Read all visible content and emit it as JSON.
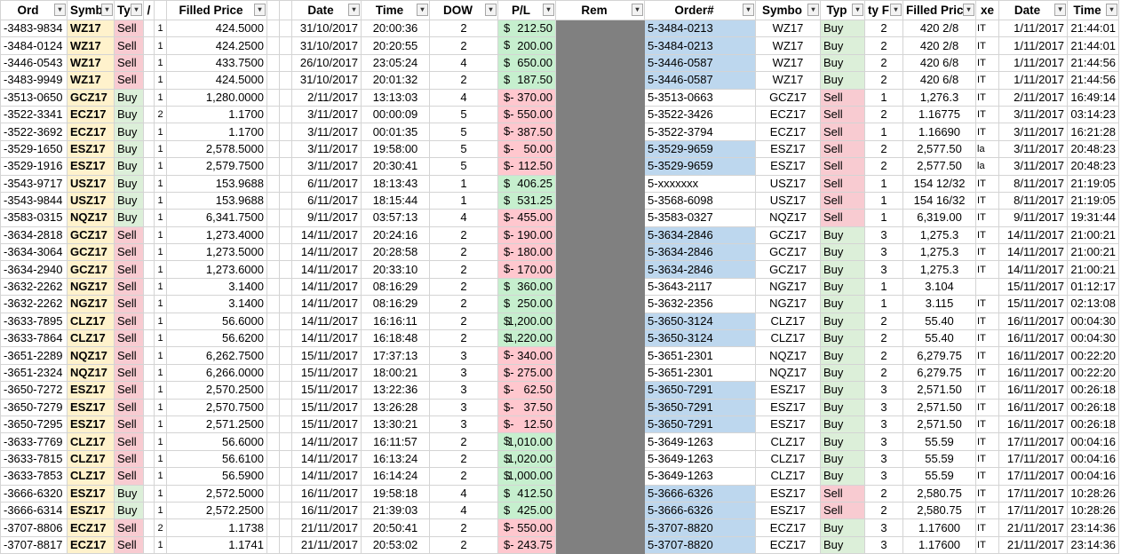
{
  "headers": {
    "ord": "Ord",
    "symb": "Symb",
    "ty": "Ty",
    "q": "/",
    "filled_price": "Filled Price",
    "date": "Date",
    "time": "Time",
    "dow": "DOW",
    "pl": "P/L",
    "rem": "Rem",
    "order_no": "Order#",
    "symbol2": "Symbo",
    "type2": "Typ",
    "qty2": "ty F",
    "filled_price2": "Filled Pric",
    "ex": "xe",
    "date2": "Date",
    "time2": "Time"
  },
  "currency_symbol": "$",
  "rows": [
    {
      "ord": "-3483-9834",
      "sym": "WZ17",
      "ty": "Sell",
      "q": "1",
      "fp": "424.5000",
      "date": "31/10/2017",
      "time": "20:00:36",
      "dow": "2",
      "sign": "",
      "pl": "212.50",
      "ord2": "5-3484-0213",
      "blue": true,
      "sym2": "WZ17",
      "ty2": "Buy",
      "q2": "2",
      "fp2": "420 2/8",
      "ex": "IT",
      "date2": "1/11/2017",
      "time2": "21:44:01"
    },
    {
      "ord": "-3484-0124",
      "sym": "WZ17",
      "ty": "Sell",
      "q": "1",
      "fp": "424.2500",
      "date": "31/10/2017",
      "time": "20:20:55",
      "dow": "2",
      "sign": "",
      "pl": "200.00",
      "ord2": "5-3484-0213",
      "blue": true,
      "sym2": "WZ17",
      "ty2": "Buy",
      "q2": "2",
      "fp2": "420 2/8",
      "ex": "IT",
      "date2": "1/11/2017",
      "time2": "21:44:01"
    },
    {
      "ord": "-3446-0543",
      "sym": "WZ17",
      "ty": "Sell",
      "q": "1",
      "fp": "433.7500",
      "date": "26/10/2017",
      "time": "23:05:24",
      "dow": "4",
      "sign": "",
      "pl": "650.00",
      "ord2": "5-3446-0587",
      "blue": true,
      "sym2": "WZ17",
      "ty2": "Buy",
      "q2": "2",
      "fp2": "420 6/8",
      "ex": "IT",
      "date2": "1/11/2017",
      "time2": "21:44:56"
    },
    {
      "ord": "-3483-9949",
      "sym": "WZ17",
      "ty": "Sell",
      "q": "1",
      "fp": "424.5000",
      "date": "31/10/2017",
      "time": "20:01:32",
      "dow": "2",
      "sign": "",
      "pl": "187.50",
      "ord2": "5-3446-0587",
      "blue": true,
      "sym2": "WZ17",
      "ty2": "Buy",
      "q2": "2",
      "fp2": "420 6/8",
      "ex": "IT",
      "date2": "1/11/2017",
      "time2": "21:44:56"
    },
    {
      "ord": "-3513-0650",
      "sym": "GCZ17",
      "ty": "Buy",
      "q": "1",
      "fp": "1,280.0000",
      "date": "2/11/2017",
      "time": "13:13:03",
      "dow": "4",
      "sign": "-",
      "pl": "370.00",
      "ord2": "5-3513-0663",
      "blue": false,
      "sym2": "GCZ17",
      "ty2": "Sell",
      "q2": "1",
      "fp2": "1,276.3",
      "ex": "IT",
      "date2": "2/11/2017",
      "time2": "16:49:14"
    },
    {
      "ord": "-3522-3341",
      "sym": "ECZ17",
      "ty": "Buy",
      "q": "2",
      "fp": "1.1700",
      "date": "3/11/2017",
      "time": "00:00:09",
      "dow": "5",
      "sign": "-",
      "pl": "550.00",
      "ord2": "5-3522-3426",
      "blue": false,
      "sym2": "ECZ17",
      "ty2": "Sell",
      "q2": "2",
      "fp2": "1.16775",
      "ex": "IT",
      "date2": "3/11/2017",
      "time2": "03:14:23"
    },
    {
      "ord": "-3522-3692",
      "sym": "ECZ17",
      "ty": "Buy",
      "q": "1",
      "fp": "1.1700",
      "date": "3/11/2017",
      "time": "00:01:35",
      "dow": "5",
      "sign": "-",
      "pl": "387.50",
      "ord2": "5-3522-3794",
      "blue": false,
      "sym2": "ECZ17",
      "ty2": "Sell",
      "q2": "1",
      "fp2": "1.16690",
      "ex": "IT",
      "date2": "3/11/2017",
      "time2": "16:21:28"
    },
    {
      "ord": "-3529-1650",
      "sym": "ESZ17",
      "ty": "Buy",
      "q": "1",
      "fp": "2,578.5000",
      "date": "3/11/2017",
      "time": "19:58:00",
      "dow": "5",
      "sign": "-",
      "pl": "50.00",
      "ord2": "5-3529-9659",
      "blue": true,
      "sym2": "ESZ17",
      "ty2": "Sell",
      "q2": "2",
      "fp2": "2,577.50",
      "ex": "la",
      "date2": "3/11/2017",
      "time2": "20:48:23"
    },
    {
      "ord": "-3529-1916",
      "sym": "ESZ17",
      "ty": "Buy",
      "q": "1",
      "fp": "2,579.7500",
      "date": "3/11/2017",
      "time": "20:30:41",
      "dow": "5",
      "sign": "-",
      "pl": "112.50",
      "ord2": "5-3529-9659",
      "blue": true,
      "sym2": "ESZ17",
      "ty2": "Sell",
      "q2": "2",
      "fp2": "2,577.50",
      "ex": "la",
      "date2": "3/11/2017",
      "time2": "20:48:23"
    },
    {
      "ord": "-3543-9717",
      "sym": "USZ17",
      "ty": "Buy",
      "q": "1",
      "fp": "153.9688",
      "date": "6/11/2017",
      "time": "18:13:43",
      "dow": "1",
      "sign": "",
      "pl": "406.25",
      "ord2": "5-xxxxxxx",
      "blue": false,
      "sym2": "USZ17",
      "ty2": "Sell",
      "q2": "1",
      "fp2": "154 12/32",
      "ex": "IT",
      "date2": "8/11/2017",
      "time2": "21:19:05"
    },
    {
      "ord": "-3543-9844",
      "sym": "USZ17",
      "ty": "Buy",
      "q": "1",
      "fp": "153.9688",
      "date": "6/11/2017",
      "time": "18:15:44",
      "dow": "1",
      "sign": "",
      "pl": "531.25",
      "ord2": "5-3568-6098",
      "blue": false,
      "sym2": "USZ17",
      "ty2": "Sell",
      "q2": "1",
      "fp2": "154 16/32",
      "ex": "IT",
      "date2": "8/11/2017",
      "time2": "21:19:05"
    },
    {
      "ord": "-3583-0315",
      "sym": "NQZ17",
      "ty": "Buy",
      "q": "1",
      "fp": "6,341.7500",
      "date": "9/11/2017",
      "time": "03:57:13",
      "dow": "4",
      "sign": "-",
      "pl": "455.00",
      "ord2": "5-3583-0327",
      "blue": false,
      "sym2": "NQZ17",
      "ty2": "Sell",
      "q2": "1",
      "fp2": "6,319.00",
      "ex": "IT",
      "date2": "9/11/2017",
      "time2": "19:31:44"
    },
    {
      "ord": "-3634-2818",
      "sym": "GCZ17",
      "ty": "Sell",
      "q": "1",
      "fp": "1,273.4000",
      "date": "14/11/2017",
      "time": "20:24:16",
      "dow": "2",
      "sign": "-",
      "pl": "190.00",
      "ord2": "5-3634-2846",
      "blue": true,
      "sym2": "GCZ17",
      "ty2": "Buy",
      "q2": "3",
      "fp2": "1,275.3",
      "ex": "IT",
      "date2": "14/11/2017",
      "time2": "21:00:21"
    },
    {
      "ord": "-3634-3064",
      "sym": "GCZ17",
      "ty": "Sell",
      "q": "1",
      "fp": "1,273.5000",
      "date": "14/11/2017",
      "time": "20:28:58",
      "dow": "2",
      "sign": "-",
      "pl": "180.00",
      "ord2": "5-3634-2846",
      "blue": true,
      "sym2": "GCZ17",
      "ty2": "Buy",
      "q2": "3",
      "fp2": "1,275.3",
      "ex": "IT",
      "date2": "14/11/2017",
      "time2": "21:00:21"
    },
    {
      "ord": "-3634-2940",
      "sym": "GCZ17",
      "ty": "Sell",
      "q": "1",
      "fp": "1,273.6000",
      "date": "14/11/2017",
      "time": "20:33:10",
      "dow": "2",
      "sign": "-",
      "pl": "170.00",
      "ord2": "5-3634-2846",
      "blue": true,
      "sym2": "GCZ17",
      "ty2": "Buy",
      "q2": "3",
      "fp2": "1,275.3",
      "ex": "IT",
      "date2": "14/11/2017",
      "time2": "21:00:21"
    },
    {
      "ord": "-3632-2262",
      "sym": "NGZ17",
      "ty": "Sell",
      "q": "1",
      "fp": "3.1400",
      "date": "14/11/2017",
      "time": "08:16:29",
      "dow": "2",
      "sign": "",
      "pl": "360.00",
      "ord2": "5-3643-2117",
      "blue": false,
      "sym2": "NGZ17",
      "ty2": "Buy",
      "q2": "1",
      "fp2": "3.104",
      "ex": "",
      "date2": "15/11/2017",
      "time2": "01:12:17"
    },
    {
      "ord": "-3632-2262",
      "sym": "NGZ17",
      "ty": "Sell",
      "q": "1",
      "fp": "3.1400",
      "date": "14/11/2017",
      "time": "08:16:29",
      "dow": "2",
      "sign": "",
      "pl": "250.00",
      "ord2": "5-3632-2356",
      "blue": false,
      "sym2": "NGZ17",
      "ty2": "Buy",
      "q2": "1",
      "fp2": "3.115",
      "ex": "IT",
      "date2": "15/11/2017",
      "time2": "02:13:08"
    },
    {
      "ord": "-3633-7895",
      "sym": "CLZ17",
      "ty": "Sell",
      "q": "1",
      "fp": "56.6000",
      "date": "14/11/2017",
      "time": "16:16:11",
      "dow": "2",
      "sign": "",
      "pl": "1,200.00",
      "ord2": "5-3650-3124",
      "blue": true,
      "sym2": "CLZ17",
      "ty2": "Buy",
      "q2": "2",
      "fp2": "55.40",
      "ex": "IT",
      "date2": "16/11/2017",
      "time2": "00:04:30"
    },
    {
      "ord": "-3633-7864",
      "sym": "CLZ17",
      "ty": "Sell",
      "q": "1",
      "fp": "56.6200",
      "date": "14/11/2017",
      "time": "16:18:48",
      "dow": "2",
      "sign": "",
      "pl": "1,220.00",
      "ord2": "5-3650-3124",
      "blue": true,
      "sym2": "CLZ17",
      "ty2": "Buy",
      "q2": "2",
      "fp2": "55.40",
      "ex": "IT",
      "date2": "16/11/2017",
      "time2": "00:04:30"
    },
    {
      "ord": "-3651-2289",
      "sym": "NQZ17",
      "ty": "Sell",
      "q": "1",
      "fp": "6,262.7500",
      "date": "15/11/2017",
      "time": "17:37:13",
      "dow": "3",
      "sign": "-",
      "pl": "340.00",
      "ord2": "5-3651-2301",
      "blue": false,
      "sym2": "NQZ17",
      "ty2": "Buy",
      "q2": "2",
      "fp2": "6,279.75",
      "ex": "IT",
      "date2": "16/11/2017",
      "time2": "00:22:20"
    },
    {
      "ord": "-3651-2324",
      "sym": "NQZ17",
      "ty": "Sell",
      "q": "1",
      "fp": "6,266.0000",
      "date": "15/11/2017",
      "time": "18:00:21",
      "dow": "3",
      "sign": "-",
      "pl": "275.00",
      "ord2": "5-3651-2301",
      "blue": false,
      "sym2": "NQZ17",
      "ty2": "Buy",
      "q2": "2",
      "fp2": "6,279.75",
      "ex": "IT",
      "date2": "16/11/2017",
      "time2": "00:22:20"
    },
    {
      "ord": "-3650-7272",
      "sym": "ESZ17",
      "ty": "Sell",
      "q": "1",
      "fp": "2,570.2500",
      "date": "15/11/2017",
      "time": "13:22:36",
      "dow": "3",
      "sign": "-",
      "pl": "62.50",
      "ord2": "5-3650-7291",
      "blue": true,
      "sym2": "ESZ17",
      "ty2": "Buy",
      "q2": "3",
      "fp2": "2,571.50",
      "ex": "IT",
      "date2": "16/11/2017",
      "time2": "00:26:18"
    },
    {
      "ord": "-3650-7279",
      "sym": "ESZ17",
      "ty": "Sell",
      "q": "1",
      "fp": "2,570.7500",
      "date": "15/11/2017",
      "time": "13:26:28",
      "dow": "3",
      "sign": "-",
      "pl": "37.50",
      "ord2": "5-3650-7291",
      "blue": true,
      "sym2": "ESZ17",
      "ty2": "Buy",
      "q2": "3",
      "fp2": "2,571.50",
      "ex": "IT",
      "date2": "16/11/2017",
      "time2": "00:26:18"
    },
    {
      "ord": "-3650-7295",
      "sym": "ESZ17",
      "ty": "Sell",
      "q": "1",
      "fp": "2,571.2500",
      "date": "15/11/2017",
      "time": "13:30:21",
      "dow": "3",
      "sign": "-",
      "pl": "12.50",
      "ord2": "5-3650-7291",
      "blue": true,
      "sym2": "ESZ17",
      "ty2": "Buy",
      "q2": "3",
      "fp2": "2,571.50",
      "ex": "IT",
      "date2": "16/11/2017",
      "time2": "00:26:18"
    },
    {
      "ord": "-3633-7769",
      "sym": "CLZ17",
      "ty": "Sell",
      "q": "1",
      "fp": "56.6000",
      "date": "14/11/2017",
      "time": "16:11:57",
      "dow": "2",
      "sign": "",
      "pl": "1,010.00",
      "ord2": "5-3649-1263",
      "blue": false,
      "sym2": "CLZ17",
      "ty2": "Buy",
      "q2": "3",
      "fp2": "55.59",
      "ex": "IT",
      "date2": "17/11/2017",
      "time2": "00:04:16"
    },
    {
      "ord": "-3633-7815",
      "sym": "CLZ17",
      "ty": "Sell",
      "q": "1",
      "fp": "56.6100",
      "date": "14/11/2017",
      "time": "16:13:24",
      "dow": "2",
      "sign": "",
      "pl": "1,020.00",
      "ord2": "5-3649-1263",
      "blue": false,
      "sym2": "CLZ17",
      "ty2": "Buy",
      "q2": "3",
      "fp2": "55.59",
      "ex": "IT",
      "date2": "17/11/2017",
      "time2": "00:04:16"
    },
    {
      "ord": "-3633-7853",
      "sym": "CLZ17",
      "ty": "Sell",
      "q": "1",
      "fp": "56.5900",
      "date": "14/11/2017",
      "time": "16:14:24",
      "dow": "2",
      "sign": "",
      "pl": "1,000.00",
      "ord2": "5-3649-1263",
      "blue": false,
      "sym2": "CLZ17",
      "ty2": "Buy",
      "q2": "3",
      "fp2": "55.59",
      "ex": "IT",
      "date2": "17/11/2017",
      "time2": "00:04:16"
    },
    {
      "ord": "-3666-6320",
      "sym": "ESZ17",
      "ty": "Buy",
      "q": "1",
      "fp": "2,572.5000",
      "date": "16/11/2017",
      "time": "19:58:18",
      "dow": "4",
      "sign": "",
      "pl": "412.50",
      "ord2": "5-3666-6326",
      "blue": true,
      "sym2": "ESZ17",
      "ty2": "Sell",
      "q2": "2",
      "fp2": "2,580.75",
      "ex": "IT",
      "date2": "17/11/2017",
      "time2": "10:28:26"
    },
    {
      "ord": "-3666-6314",
      "sym": "ESZ17",
      "ty": "Buy",
      "q": "1",
      "fp": "2,572.2500",
      "date": "16/11/2017",
      "time": "21:39:03",
      "dow": "4",
      "sign": "",
      "pl": "425.00",
      "ord2": "5-3666-6326",
      "blue": true,
      "sym2": "ESZ17",
      "ty2": "Sell",
      "q2": "2",
      "fp2": "2,580.75",
      "ex": "IT",
      "date2": "17/11/2017",
      "time2": "10:28:26"
    },
    {
      "ord": "-3707-8806",
      "sym": "ECZ17",
      "ty": "Sell",
      "q": "2",
      "fp": "1.1738",
      "date": "21/11/2017",
      "time": "20:50:41",
      "dow": "2",
      "sign": "-",
      "pl": "550.00",
      "ord2": "5-3707-8820",
      "blue": true,
      "sym2": "ECZ17",
      "ty2": "Buy",
      "q2": "3",
      "fp2": "1.17600",
      "ex": "IT",
      "date2": "21/11/2017",
      "time2": "23:14:36"
    },
    {
      "ord": "-3707-8817",
      "sym": "ECZ17",
      "ty": "Sell",
      "q": "1",
      "fp": "1.1741",
      "date": "21/11/2017",
      "time": "20:53:02",
      "dow": "2",
      "sign": "-",
      "pl": "243.75",
      "ord2": "5-3707-8820",
      "blue": true,
      "sym2": "ECZ17",
      "ty2": "Buy",
      "q2": "3",
      "fp2": "1.17600",
      "ex": "IT",
      "date2": "21/11/2017",
      "time2": "23:14:36"
    }
  ]
}
